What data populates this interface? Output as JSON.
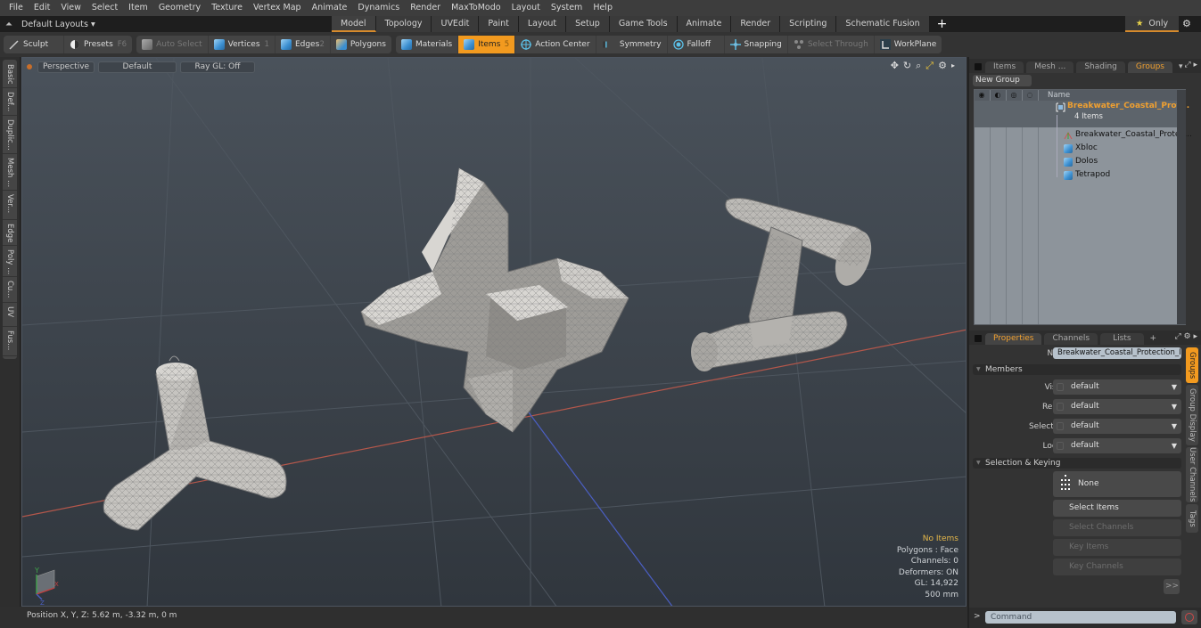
{
  "menu": [
    "File",
    "Edit",
    "View",
    "Select",
    "Item",
    "Geometry",
    "Texture",
    "Vertex Map",
    "Animate",
    "Dynamics",
    "Render",
    "MaxToModo",
    "Layout",
    "System",
    "Help"
  ],
  "layout_selector": "Default Layouts ▾",
  "layout_tabs": [
    {
      "label": "Model",
      "active": true
    },
    {
      "label": "Topology"
    },
    {
      "label": "UVEdit"
    },
    {
      "label": "Paint"
    },
    {
      "label": "Layout"
    },
    {
      "label": "Setup"
    },
    {
      "label": "Game Tools"
    },
    {
      "label": "Animate"
    },
    {
      "label": "Render"
    },
    {
      "label": "Scripting"
    },
    {
      "label": "Schematic Fusion"
    }
  ],
  "only_label": "Only",
  "toolbar": {
    "sculpt": "Sculpt",
    "presets": "Presets",
    "presets_key": "F6",
    "auto_select": "Auto Select",
    "vertices": "Vertices",
    "vertices_key": "1",
    "edges": "Edges",
    "edges_key": "2",
    "polygons": "Polygons",
    "materials": "Materials",
    "items": "Items",
    "items_key": "5",
    "action_center": "Action Center",
    "symmetry": "Symmetry",
    "falloff": "Falloff",
    "snapping": "Snapping",
    "select_through": "Select Through",
    "workplane": "WorkPlane"
  },
  "left_tabs": [
    "Basic",
    "Def...",
    "Duplic...",
    "Mesh ...",
    "Ver...",
    "Edge",
    "Poly ...",
    "Cu...",
    "UV",
    "Fus..."
  ],
  "viewport": {
    "view": "Perspective",
    "shading": "Default",
    "raygl": "Ray GL: Off",
    "info": {
      "items": "No Items",
      "polygons": "Polygons : Face",
      "channels": "Channels: 0",
      "deformers": "Deformers: ON",
      "gl": "GL: 14,922",
      "unit": "500 mm"
    }
  },
  "status": {
    "position": "Position X, Y, Z:   5.62 m, -3.32 m, 0 m"
  },
  "groups_panel": {
    "tabs": [
      {
        "label": "Items"
      },
      {
        "label": "Mesh ..."
      },
      {
        "label": "Shading"
      },
      {
        "label": "Groups",
        "active": true
      }
    ],
    "new_group": "New Group",
    "name_header": "Name",
    "group_name": "Breakwater_Coastal_Prot...",
    "group_count": "4 Items",
    "items": [
      {
        "label": "Breakwater_Coastal_Protec...",
        "icon": "locator-icon"
      },
      {
        "label": "Xbloc",
        "icon": "mesh-icon"
      },
      {
        "label": "Dolos",
        "icon": "mesh-icon"
      },
      {
        "label": "Tetrapod",
        "icon": "mesh-icon"
      }
    ]
  },
  "properties_panel": {
    "tabs": [
      {
        "label": "Properties",
        "active": true
      },
      {
        "label": "Channels"
      },
      {
        "label": "Lists"
      }
    ],
    "name_label": "Name",
    "name_value": "Breakwater_Coastal_Protection_I",
    "members_section": "Members",
    "members": [
      {
        "label": "Visible",
        "value": "default"
      },
      {
        "label": "Render",
        "value": "default"
      },
      {
        "label": "Selectable",
        "value": "default"
      },
      {
        "label": "Locked",
        "value": "default"
      }
    ],
    "selkey_section": "Selection & Keying",
    "none_label": "None",
    "select_items": "Select Items",
    "select_channels": "Select Channels",
    "key_items": "Key Items",
    "key_channels": "Key Channels",
    "more": ">>",
    "side_tabs": [
      "Groups",
      "Group Display",
      "User Channels",
      "Tags"
    ]
  },
  "command": {
    "prompt": ">",
    "placeholder": "Command"
  },
  "colors": {
    "accent": "#f29a1f",
    "group_name": "#f0a030",
    "info_highlight": "#e6b84a"
  }
}
